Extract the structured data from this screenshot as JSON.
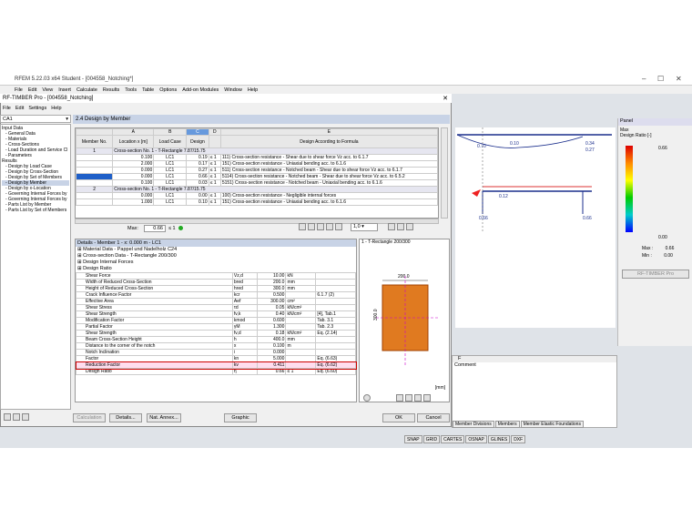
{
  "app": {
    "title": "RFEM 5.22.03 x64 Student - [004558_Notching*]",
    "menus": [
      "File",
      "Edit",
      "View",
      "Insert",
      "Calculate",
      "Results",
      "Tools",
      "Table",
      "Options",
      "Add-on Modules",
      "Window",
      "Help"
    ]
  },
  "dialog": {
    "title": "RF-TIMBER Pro - [004558_Notching]",
    "menus": [
      "File",
      "Edit",
      "Settings",
      "Help"
    ],
    "case": "CA1",
    "heading": "2.4  Design by Member"
  },
  "tree": [
    "Input Data",
    "- General Data",
    "- Materials",
    "- Cross-Sections",
    "- Load Duration and Service Cl",
    "- Parameters",
    "Results",
    "- Design by Load Case",
    "- Design by Cross-Section",
    "- Design by Set of Members",
    "- Design by Member",
    "- Design by x-Location",
    "- Governing Internal Forces by",
    "- Governing Internal Forces by",
    "- Parts List by Member",
    "- Parts List by Set of Members"
  ],
  "grid": {
    "col_letters": [
      "A",
      "B",
      "C",
      "D",
      "E"
    ],
    "headers": [
      "Member No.",
      "Location x [m]",
      "Load Case",
      "Design",
      "",
      "Design According to Formula"
    ],
    "sections": [
      {
        "member": "1",
        "label": "Cross-section No.  1 - T-Rectangle 7.87/15.75",
        "rows": [
          [
            "0.100",
            "LC1",
            "0.19",
            "≤ 1",
            "111) Cross-section resistance - Shear due to shear force Vz acc. to 6.1.7"
          ],
          [
            "2.000",
            "LC1",
            "0.17",
            "≤ 1",
            "151) Cross-section resistance - Uniaxial bending acc. to 6.1.6"
          ],
          [
            "0.000",
            "LC1",
            "0.27",
            "≤ 1",
            "511) Cross-section resistance - Notched beam - Shear due to shear force Vz acc. to 6.1.7"
          ],
          [
            "0.000",
            "LC1",
            "0.66",
            "≤ 1",
            "5114) Cross-section resistance - Notched beam - Shear due to shear force Vz acc. to 6.5.2"
          ],
          [
            "0.100",
            "LC1",
            "0.03",
            "≤ 1",
            "5151) Cross-section resistance - Notched beam - Uniaxial bending acc. to 6.1.6"
          ]
        ]
      },
      {
        "member": "2",
        "label": "Cross-section No.  1 - T-Rectangle 7.87/15.75",
        "rows": [
          [
            "0.000",
            "LC1",
            "0.00",
            "≤ 1",
            "100) Cross-section resistance - Negligible internal forces"
          ],
          [
            "1.000",
            "LC1",
            "0.10",
            "≤ 1",
            "151) Cross-section resistance - Uniaxial bending acc. to 6.1.6"
          ]
        ]
      }
    ],
    "max_label": "Max:",
    "max_value": "0.66",
    "max_cond": "≤ 1"
  },
  "details": {
    "title": "Details - Member 1 - x: 0.000 m - LC1",
    "groups": [
      "Material Data - Pappel und Nadelholz C24",
      "Cross-section Data - T-Rectangle 200/300",
      "Design Internal Forces",
      "Design Ratio"
    ],
    "rows": [
      [
        "Shear Force",
        "Vz,d",
        "10.00",
        "kN",
        ""
      ],
      [
        "Width of Reduced Cross-Section",
        "bred",
        "200.0",
        "mm",
        ""
      ],
      [
        "Height of Reduced Cross-Section",
        "hred",
        "300.0",
        "mm",
        ""
      ],
      [
        "Crack Influence Factor",
        "kcr",
        "0.500",
        "",
        "6.1.7 (2)"
      ],
      [
        "Effective Area",
        "Aef",
        "300.00",
        "cm²",
        ""
      ],
      [
        "Shear Stress",
        "τd",
        "0.05",
        "kN/cm²",
        ""
      ],
      [
        "Shear Strength",
        "fv,k",
        "0.40",
        "kN/cm²",
        "[4], Tab.1"
      ],
      [
        "Modification Factor",
        "kmod",
        "0.600",
        "",
        "Tab. 3.1"
      ],
      [
        "Partial Factor",
        "γM",
        "1.300",
        "",
        "Tab. 2.3"
      ],
      [
        "Shear Strength",
        "fv,d",
        "0.18",
        "kN/cm²",
        "Eq. (2.14)"
      ],
      [
        "Beam Cross-Section Height",
        "h",
        "400.0",
        "mm",
        ""
      ],
      [
        "Distance to the corner of the notch",
        "x",
        "0.100",
        "m",
        ""
      ],
      [
        "Notch Inclination",
        "i",
        "0.000",
        "",
        ""
      ],
      [
        "Factor",
        "kn",
        "5.000",
        "",
        "Eq. (6.63)"
      ],
      [
        "Reduction Factor",
        "kv",
        "0.411",
        "",
        "Eq. (6.62)"
      ],
      [
        "Design Ratio",
        "η",
        "0.66",
        "≤ 1",
        "Eq. (6.60)"
      ]
    ]
  },
  "preview": {
    "title": "1 - T-Rectangle 200/300",
    "width": "200.0",
    "height": "300.0",
    "unit": "[mm]"
  },
  "buttons": {
    "calculation": "Calculation",
    "details": "Details...",
    "nat_annex": "Nat. Annex...",
    "graphic": "Graphic",
    "ok": "OK",
    "cancel": "Cancel"
  },
  "combo": "1,0",
  "panel": {
    "title": "Panel",
    "max": "Max",
    "ratio": "Design Ratio [-]",
    "v1": "0.66",
    "v0": "0.00",
    "max_row": "Max :",
    "max_val": "0.66",
    "min_row": "Min :",
    "min_val": "0.00",
    "button": "RF-TIMBER Pro"
  },
  "model": {
    "labels": [
      "0.70",
      "0.10",
      "0.34",
      "0.27",
      "0.12",
      "0.66",
      "0.66"
    ]
  },
  "bottom": {
    "col": "F",
    "comment": "Comment",
    "tabs": [
      "Member Divisions",
      "Members",
      "Member Elastic Foundations"
    ]
  },
  "status": [
    "SNAP",
    "GRID",
    "CARTES",
    "OSNAP",
    "GLINES",
    "DXF"
  ]
}
